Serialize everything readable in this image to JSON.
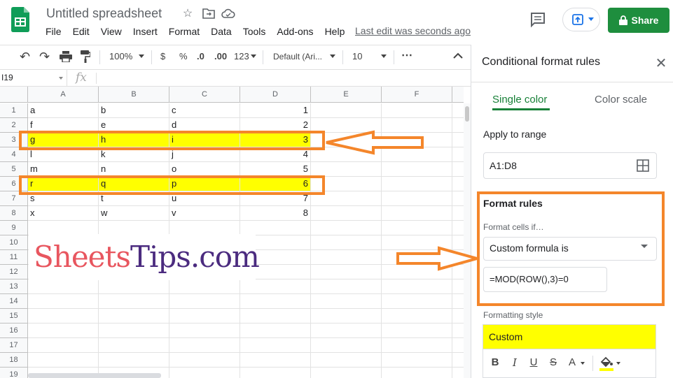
{
  "app": {
    "doc_title": "Untitled spreadsheet",
    "last_edit": "Last edit was seconds ago",
    "share_label": "Share",
    "menu": [
      "File",
      "Edit",
      "View",
      "Insert",
      "Format",
      "Data",
      "Tools",
      "Add-ons",
      "Help"
    ]
  },
  "toolbar": {
    "zoom": "100%",
    "currency": "$",
    "percent": "%",
    "dec_decrease": ".0",
    "dec_increase": ".00",
    "more_formats": "123",
    "font": "Default (Ari...",
    "font_size": "10",
    "more": "⋯"
  },
  "formula_bar": {
    "name_box": "I19",
    "fx": "fx"
  },
  "sheet": {
    "columns": [
      "A",
      "B",
      "C",
      "D",
      "E",
      "F"
    ],
    "row_numbers": [
      "1",
      "2",
      "3",
      "4",
      "5",
      "6",
      "7",
      "8",
      "9",
      "10",
      "11",
      "12",
      "13",
      "14",
      "15",
      "16",
      "17",
      "18",
      "19"
    ],
    "rows": [
      {
        "a": "a",
        "b": "b",
        "c": "c",
        "d": "1",
        "highlight": false
      },
      {
        "a": "f",
        "b": "e",
        "c": "d",
        "d": "2",
        "highlight": false
      },
      {
        "a": "g",
        "b": "h",
        "c": "i",
        "d": "3",
        "highlight": true
      },
      {
        "a": "l",
        "b": "k",
        "c": "j",
        "d": "4",
        "highlight": false
      },
      {
        "a": "m",
        "b": "n",
        "c": "o",
        "d": "5",
        "highlight": false
      },
      {
        "a": "r",
        "b": "q",
        "c": "p",
        "d": "6",
        "highlight": true
      },
      {
        "a": "s",
        "b": "t",
        "c": "u",
        "d": "7",
        "highlight": false
      },
      {
        "a": "x",
        "b": "w",
        "c": "v",
        "d": "8",
        "highlight": false
      }
    ]
  },
  "watermark": {
    "part1": "Sheets",
    "part2": "Tips.com",
    "color1": "#e8565f",
    "color2": "#4b2b7f"
  },
  "panel": {
    "title": "Conditional format rules",
    "tab_single": "Single color",
    "tab_scale": "Color scale",
    "apply_label": "Apply to range",
    "range": "A1:D8",
    "format_rules_label": "Format rules",
    "condition_label": "Format cells if…",
    "condition_value": "Custom formula is",
    "formula": "=MOD(ROW(),3)=0",
    "style_label": "Formatting style",
    "style_preview": "Custom"
  },
  "colors": {
    "highlight": "#ffff00",
    "annotation": "#f4862b",
    "share_green": "#1e8e3e",
    "tab_green": "#188038"
  }
}
